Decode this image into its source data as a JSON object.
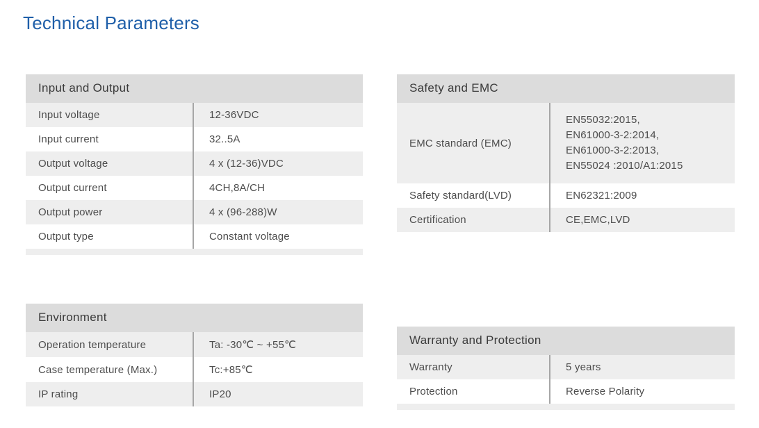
{
  "page": {
    "title": "Technical Parameters",
    "title_color": "#1f5fa9",
    "header_bg": "#dcdcdc",
    "stripe_bg": "#eeeeee",
    "divider_color": "#a6a6a6",
    "text_color": "#4d4d4d"
  },
  "tables": {
    "input_output": {
      "header": "Input and Output",
      "rows": [
        {
          "label": "Input voltage",
          "value": "12-36VDC"
        },
        {
          "label": "Input current",
          "value": "32..5A"
        },
        {
          "label": "Output voltage",
          "value": "4 x (12-36)VDC"
        },
        {
          "label": "Output current",
          "value": "4CH,8A/CH"
        },
        {
          "label": "Output power",
          "value": "4 x (96-288)W"
        },
        {
          "label": "Output type",
          "value": "Constant voltage"
        }
      ]
    },
    "safety_emc": {
      "header": "Safety and EMC",
      "rows": [
        {
          "label": "EMC standard (EMC)",
          "value": "EN55032:2015,\nEN61000-3-2:2014,\nEN61000-3-2:2013,\nEN55024 :2010/A1:2015"
        },
        {
          "label": "Safety standard(LVD)",
          "value": "EN62321:2009"
        },
        {
          "label": "Certification",
          "value": "CE,EMC,LVD"
        }
      ]
    },
    "environment": {
      "header": "Environment",
      "rows": [
        {
          "label": "Operation temperature",
          "value": "Ta: -30℃ ~ +55℃"
        },
        {
          "label": "Case temperature (Max.)",
          "value": "Tc:+85℃"
        },
        {
          "label": "IP rating",
          "value": "IP20"
        }
      ]
    },
    "warranty_protection": {
      "header": "Warranty and Protection",
      "rows": [
        {
          "label": "Warranty",
          "value": "5 years"
        },
        {
          "label": "Protection",
          "value": "Reverse Polarity"
        }
      ]
    }
  }
}
